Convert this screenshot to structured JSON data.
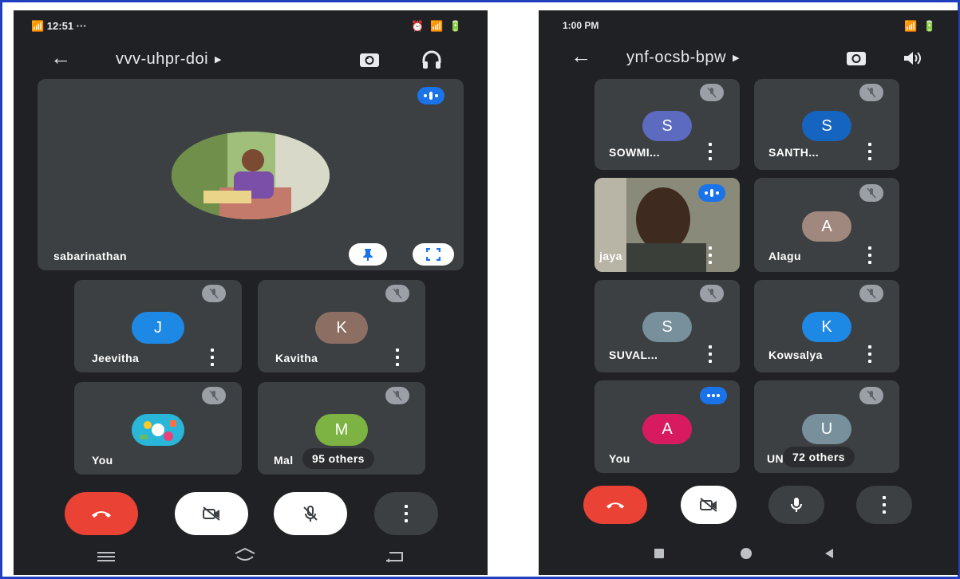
{
  "colors": {
    "background": "#202124",
    "tile": "#3c4043",
    "end_call": "#ea4335",
    "speaking_badge": "#1a73e8",
    "frame_border": "#1f3fbf"
  },
  "left_phone": {
    "status": {
      "left": "📶 12:51 ···",
      "right": "⏰ 📶 🔋"
    },
    "meeting_code": "vvv-uhpr-doi",
    "pinned": {
      "name": "sabarinathan"
    },
    "participants": [
      {
        "name": "Jeevitha",
        "initial": "J",
        "color": "#1e88e5"
      },
      {
        "name": "Kavitha",
        "initial": "K",
        "color": "#8d6e63"
      },
      {
        "name": "You",
        "initial": "",
        "color": "#26a69a"
      },
      {
        "name": "Mal",
        "initial": "M",
        "color": "#7cb342",
        "others": "95 others"
      }
    ],
    "icons": [
      "back-arrow-icon",
      "switch-camera-icon",
      "headphones-icon",
      "pin-icon",
      "fullscreen-icon"
    ]
  },
  "right_phone": {
    "status": {
      "left": "1:00 PM",
      "right": "📶 🔋"
    },
    "meeting_code": "ynf-ocsb-bpw",
    "participants": [
      {
        "name": "SOWMI...",
        "initial": "S",
        "color": "#5c6bc0"
      },
      {
        "name": "SANTH...",
        "initial": "S",
        "color": "#1565c0"
      },
      {
        "name": "jaya",
        "initial": "",
        "color": "#6d5a40"
      },
      {
        "name": "Alagu",
        "initial": "A",
        "color": "#a1887f"
      },
      {
        "name": "SUVAL...",
        "initial": "S",
        "color": "#78909c"
      },
      {
        "name": "Kowsalya",
        "initial": "K",
        "color": "#1e88e5"
      },
      {
        "name": "You",
        "initial": "A",
        "color": "#d81b60"
      },
      {
        "name": "UN",
        "initial": "U",
        "color": "#78909c",
        "others": "72 others"
      }
    ],
    "icons": [
      "back-arrow-icon",
      "switch-camera-icon",
      "speaker-icon"
    ]
  }
}
